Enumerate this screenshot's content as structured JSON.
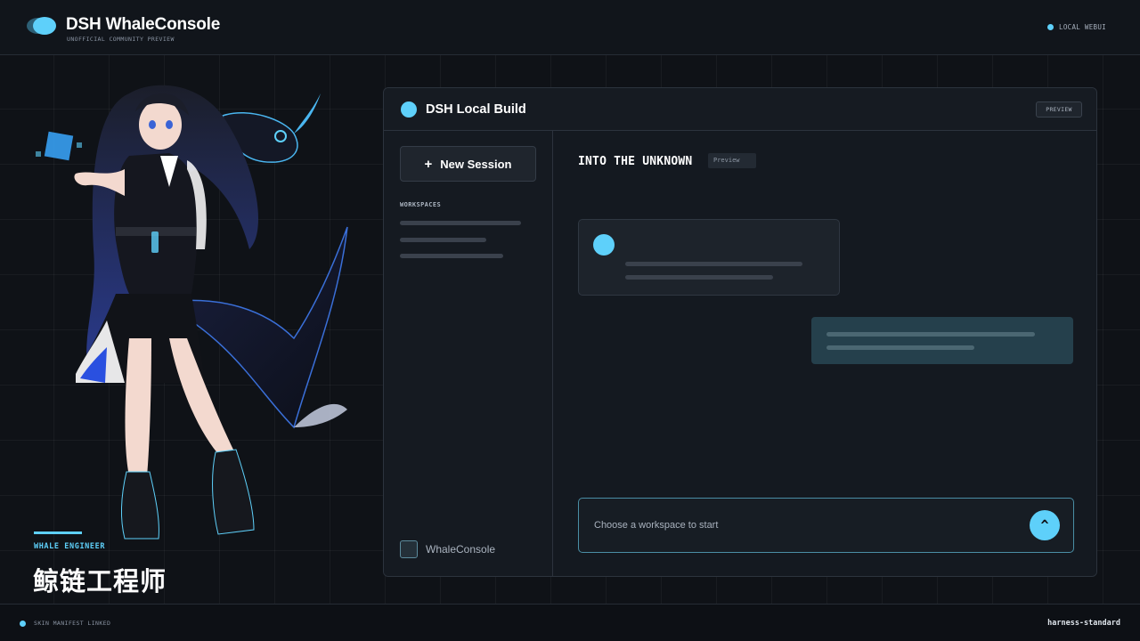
{
  "header": {
    "title": "DSH WhaleConsole",
    "subtitle": "UNOFFICIAL COMMUNITY PREVIEW",
    "status_label": "LOCAL WEBUI",
    "logo_icon": "whale-logo-icon"
  },
  "hero": {
    "role_en": "WHALE ENGINEER",
    "role_cn": "鲸链工程师"
  },
  "window": {
    "title": "DSH Local Build",
    "badge": "PREVIEW",
    "sidebar": {
      "new_session_label": "New Session",
      "workspaces_label": "WORKSPACES",
      "footer_label": "WhaleConsole"
    },
    "main": {
      "title": "INTO THE UNKNOWN",
      "badge": "Preview",
      "composer_placeholder": "Choose a workspace to start",
      "send_label": "^"
    }
  },
  "footer": {
    "left_label": "SKIN MANIFEST LINKED",
    "right_label": "harness-standard"
  },
  "colors": {
    "accent": "#5ed0fa",
    "background": "#0f1217",
    "panel": "#151a21",
    "user_bubble": "#25404c"
  }
}
